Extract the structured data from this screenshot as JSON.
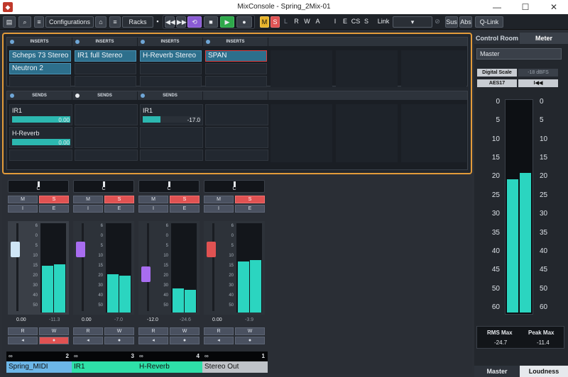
{
  "window": {
    "title": "MixConsole - Spring_2Mix-01",
    "minimize": "—",
    "maximize": "☐",
    "close": "✕"
  },
  "toolbar": {
    "configurations": "Configurations",
    "racks": "Racks",
    "m": "M",
    "s": "S",
    "l": "L",
    "r": "R",
    "w": "W",
    "a": "A",
    "i": "I",
    "e": "E",
    "cs": "CS",
    "s2": "S",
    "link": "Link",
    "sus": "Sus",
    "abs": "Abs",
    "qlink": "Q-Link"
  },
  "inserts": {
    "header": "INSERTS",
    "columns": [
      {
        "slots": [
          "Scheps 73 Stereo",
          "Neutron 2",
          ""
        ]
      },
      {
        "slots": [
          "IR1 full Stereo",
          "",
          ""
        ]
      },
      {
        "slots": [
          "H-Reverb Stereo",
          "",
          ""
        ]
      },
      {
        "slots": [
          "SPAN",
          "",
          ""
        ]
      }
    ]
  },
  "sends": {
    "header": "SENDS",
    "columns": [
      {
        "sends": [
          {
            "name": "IR1",
            "value": "0.00",
            "level": 1.0
          },
          {
            "name": "H-Reverb",
            "value": "0.00",
            "level": 1.0
          }
        ]
      },
      {
        "sends": []
      },
      {
        "sends": [
          {
            "name": "IR1",
            "value": "-17.0",
            "level": 0.3
          }
        ]
      },
      {
        "sends": []
      }
    ]
  },
  "channels": [
    {
      "name": "Spring_MIDI",
      "number": "2",
      "pan": "C",
      "fader": "0.00",
      "peak": "-11.3",
      "color": "#6cb6e8",
      "fader_pos": 0.24,
      "cap": "#cfe6f6",
      "meter_l": 0.55,
      "meter_r": 0.57
    },
    {
      "name": "IR1",
      "number": "3",
      "pan": "C",
      "fader": "0.00",
      "peak": "-7.0",
      "color": "#2ee0a8",
      "fader_pos": 0.24,
      "cap": "#a86df0",
      "meter_l": 0.45,
      "meter_r": 0.43
    },
    {
      "name": "H-Reverb",
      "number": "4",
      "pan": "C",
      "fader": "-12.0",
      "peak": "-24.6",
      "color": "#2ee0a8",
      "fader_pos": 0.55,
      "cap": "#a86df0",
      "meter_l": 0.28,
      "meter_r": 0.27
    },
    {
      "name": "Stereo Out",
      "number": "1",
      "pan": "C",
      "fader": "0.00",
      "peak": "-3.9",
      "color": "#bfc3c8",
      "fader_pos": 0.24,
      "cap": "#e05252",
      "meter_l": 0.6,
      "meter_r": 0.62
    }
  ],
  "strip_buttons": {
    "m": "M",
    "s": "S",
    "i": "I",
    "e": "E",
    "r": "R",
    "w": "W"
  },
  "fader_scale": [
    "6",
    "0",
    "5",
    "10",
    "15",
    "20",
    "30",
    "40",
    "50"
  ],
  "meter_scale": [
    "6",
    "3",
    "0",
    "5",
    "10",
    "15",
    "20",
    "30",
    "40",
    "60"
  ],
  "right_panel": {
    "tab_control_room": "Control Room",
    "tab_meter": "Meter",
    "master_label": "Master",
    "digital_scale": "Digital Scale",
    "dbfs": "-18 dBFS",
    "aes17": "AES17",
    "reset": "I◀◀",
    "scale": [
      "0",
      "5",
      "10",
      "15",
      "20",
      "25",
      "30",
      "35",
      "40",
      "45",
      "50",
      "60"
    ],
    "rms_label": "RMS Max",
    "peak_label": "Peak Max",
    "rms_value": "-24.7",
    "peak_value": "-11.4",
    "bottom_tab_master": "Master",
    "bottom_tab_loudness": "Loudness",
    "meter_l": 0.63,
    "meter_r": 0.66
  }
}
